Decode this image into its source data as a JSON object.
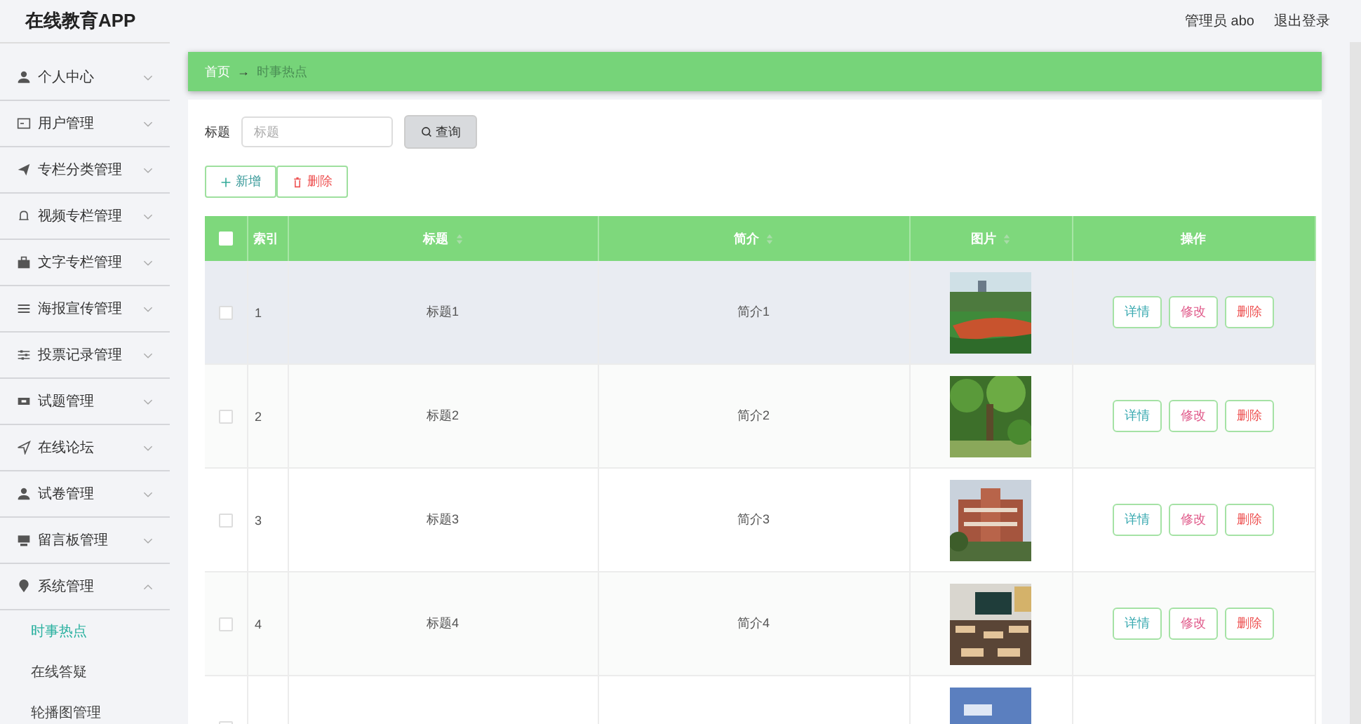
{
  "header": {
    "app_title": "在线教育APP",
    "user": "管理员 abo",
    "logout": "退出登录"
  },
  "sidebar": {
    "items": [
      {
        "label": "个人中心",
        "expanded": false
      },
      {
        "label": "用户管理",
        "expanded": false
      },
      {
        "label": "专栏分类管理",
        "expanded": false
      },
      {
        "label": "视频专栏管理",
        "expanded": false
      },
      {
        "label": "文字专栏管理",
        "expanded": false
      },
      {
        "label": "海报宣传管理",
        "expanded": false
      },
      {
        "label": "投票记录管理",
        "expanded": false
      },
      {
        "label": "试题管理",
        "expanded": false
      },
      {
        "label": "在线论坛",
        "expanded": false
      },
      {
        "label": "试卷管理",
        "expanded": false
      },
      {
        "label": "留言板管理",
        "expanded": false
      },
      {
        "label": "系统管理",
        "expanded": true,
        "children": [
          {
            "label": "时事热点",
            "selected": true
          },
          {
            "label": "在线答疑",
            "selected": false
          },
          {
            "label": "轮播图管理",
            "selected": false
          }
        ]
      }
    ]
  },
  "breadcrumb": {
    "home": "首页",
    "arrow": "→",
    "current": "时事热点"
  },
  "search": {
    "label": "标题",
    "placeholder": "标题",
    "button": "查询"
  },
  "toolbar": {
    "add": "新增",
    "delete": "删除"
  },
  "table": {
    "columns": [
      {
        "label": "索引",
        "sortable": false
      },
      {
        "label": "标题",
        "sortable": true
      },
      {
        "label": "简介",
        "sortable": true
      },
      {
        "label": "图片",
        "sortable": true
      },
      {
        "label": "操作",
        "sortable": false
      }
    ],
    "header_checked": false,
    "rows": [
      {
        "index": "1",
        "title": "标题1",
        "intro": "简介1",
        "checked": false,
        "highlighted": true,
        "actions": [
          "详情",
          "修改",
          "删除"
        ]
      },
      {
        "index": "2",
        "title": "标题2",
        "intro": "简介2",
        "checked": false,
        "highlighted": false,
        "actions": [
          "详情",
          "修改",
          "删除"
        ]
      },
      {
        "index": "3",
        "title": "标题3",
        "intro": "简介3",
        "checked": false,
        "highlighted": false,
        "actions": [
          "详情",
          "修改",
          "删除"
        ]
      },
      {
        "index": "4",
        "title": "标题4",
        "intro": "简介4",
        "checked": false,
        "highlighted": false,
        "actions": [
          "详情",
          "修改",
          "删除"
        ]
      },
      {
        "checked": false,
        "highlighted": false
      }
    ]
  }
}
